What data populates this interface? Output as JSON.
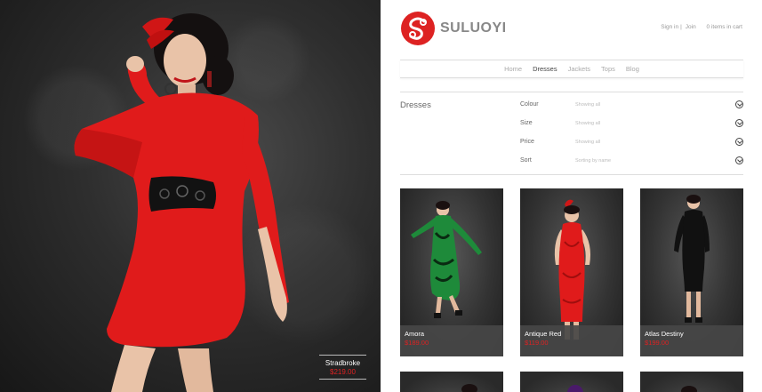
{
  "brand": {
    "name": "SULUOYI"
  },
  "account": {
    "sign_in": "Sign in",
    "join": "Join",
    "cart": "0 items in cart"
  },
  "nav": {
    "items": [
      "Home",
      "Dresses",
      "Jackets",
      "Tops",
      "Blog"
    ],
    "active": "Dresses"
  },
  "filters": {
    "title": "Dresses",
    "rows": [
      {
        "label": "Colour",
        "value": "Showing all"
      },
      {
        "label": "Size",
        "value": "Showing all"
      },
      {
        "label": "Price",
        "value": "Showing all"
      },
      {
        "label": "Sort",
        "value": "Sorting by name"
      }
    ]
  },
  "hero": {
    "name": "Stradbroke",
    "price": "$219.00"
  },
  "products": [
    {
      "name": "Amora",
      "price": "$189.00"
    },
    {
      "name": "Antique Red",
      "price": "$119.00"
    },
    {
      "name": "Atlas Destiny",
      "price": "$199.00"
    }
  ],
  "colors": {
    "accent": "#dd2222",
    "dress_red": "#e01b1b",
    "dress_green": "#1e8a3a"
  }
}
